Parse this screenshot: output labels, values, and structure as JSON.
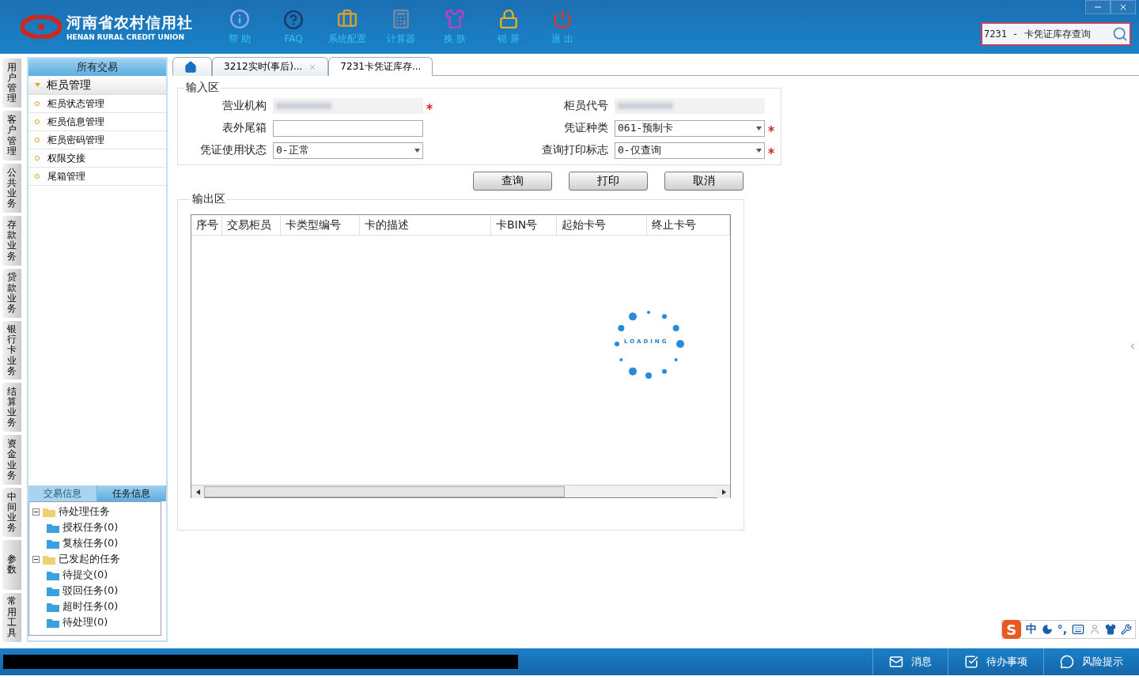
{
  "header": {
    "logo_title": "河南省农村信用社",
    "logo_subtitle": "HENAN RURAL CREDIT UNION",
    "nav": [
      {
        "label": "帮 助"
      },
      {
        "label": "FAQ"
      },
      {
        "label": "系统配置"
      },
      {
        "label": "计算器"
      },
      {
        "label": "换 肤"
      },
      {
        "label": "锁 屏"
      },
      {
        "label": "退 出"
      }
    ],
    "search": {
      "value": "7231 - 卡凭证库存查询"
    }
  },
  "side_tabs": [
    "用户管理",
    "客户管理",
    "公共业务",
    "存款业务",
    "贷款业务",
    "银行卡业务",
    "结算业务",
    "资金业务",
    "中间业务",
    "参数",
    "常用工具"
  ],
  "sidebar": {
    "title": "所有交易",
    "group": {
      "label": "柜员管理",
      "expanded": true
    },
    "items": [
      "柜员状态管理",
      "柜员信息管理",
      "柜员密码管理",
      "权限交接",
      "尾箱管理"
    ],
    "bottom_tabs": [
      {
        "label": "交易信息",
        "selected": false
      },
      {
        "label": "任务信息",
        "selected": true
      }
    ],
    "tree": [
      {
        "label": "待处理任务",
        "expanded": true,
        "children": [
          {
            "label": "授权任务(0)"
          },
          {
            "label": "复核任务(0)"
          }
        ]
      },
      {
        "label": "已发起的任务",
        "expanded": true,
        "children": [
          {
            "label": "待提交(0)"
          },
          {
            "label": "驳回任务(0)"
          },
          {
            "label": "超时任务(0)"
          },
          {
            "label": "待处理(0)"
          }
        ]
      }
    ]
  },
  "tabs": [
    {
      "kind": "home",
      "selected": false,
      "closable": false
    },
    {
      "kind": "page",
      "label": "3212实时(事后)...",
      "selected": false,
      "closable": true
    },
    {
      "kind": "page",
      "label": "7231卡凭证库存...",
      "selected": true,
      "closable": false
    }
  ],
  "input_area": {
    "title": "输入区",
    "fields": [
      {
        "label": "营业机构",
        "kind": "redacted",
        "required": true
      },
      {
        "label": "柜员代号",
        "kind": "redacted",
        "required": false
      },
      {
        "label": "表外尾箱",
        "kind": "text",
        "required": false
      },
      {
        "label": "凭证种类",
        "kind": "select",
        "value": "061-预制卡",
        "required": true
      },
      {
        "label": "凭证使用状态",
        "kind": "select",
        "value": "0-正常",
        "required": false
      },
      {
        "label": "查询打印标志",
        "kind": "select",
        "value": "0-仅查询",
        "required": true
      }
    ]
  },
  "buttons": [
    "查询",
    "打印",
    "取消"
  ],
  "output_area": {
    "title": "输出区",
    "columns": [
      "序号",
      "交易柜员",
      "卡类型编号",
      "卡的描述",
      "卡BIN号",
      "起始卡号",
      "终止卡号"
    ],
    "loading": {
      "text": "LOADING"
    }
  },
  "ime_bar": {
    "logo": "S",
    "mode": "中",
    "punct": "°,"
  },
  "status_bar": {
    "items": [
      {
        "kind": "message",
        "label": "消息"
      },
      {
        "kind": "todo",
        "label": "待办事项"
      },
      {
        "kind": "risk",
        "label": "风险提示"
      }
    ]
  }
}
